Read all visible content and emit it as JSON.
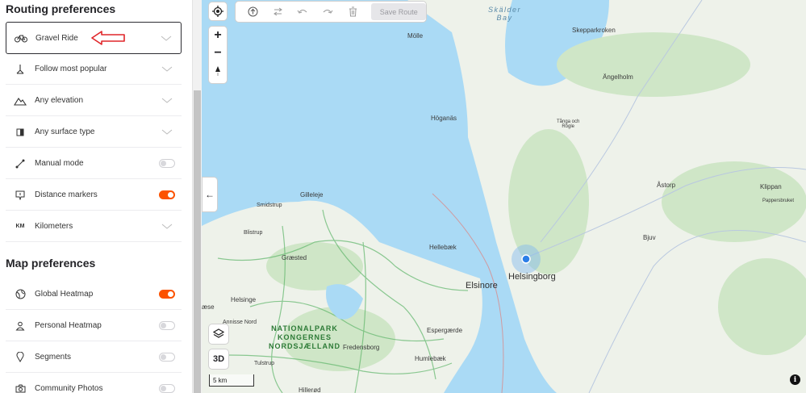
{
  "routing": {
    "title": "Routing preferences",
    "items": [
      {
        "label": "Gravel Ride",
        "control": "chevron"
      },
      {
        "label": "Follow most popular",
        "control": "chevron"
      },
      {
        "label": "Any elevation",
        "control": "chevron"
      },
      {
        "label": "Any surface type",
        "control": "chevron"
      },
      {
        "label": "Manual mode",
        "control": "toggle",
        "on": false
      },
      {
        "label": "Distance markers",
        "control": "toggle",
        "on": true
      },
      {
        "label": "Kilometers",
        "control": "chevron",
        "icon_text": "KM"
      }
    ]
  },
  "map_prefs": {
    "title": "Map preferences",
    "items": [
      {
        "label": "Global Heatmap",
        "control": "toggle",
        "on": true
      },
      {
        "label": "Personal Heatmap",
        "control": "toggle",
        "on": false
      },
      {
        "label": "Segments",
        "control": "toggle",
        "on": false
      },
      {
        "label": "Community Photos",
        "control": "toggle",
        "on": false
      }
    ]
  },
  "toolbar": {
    "save_label": "Save Route"
  },
  "map_controls": {
    "zoom_in": "+",
    "zoom_out": "−",
    "three_d": "3D",
    "info": "i",
    "collapse": "←"
  },
  "scale": {
    "label": "5 km"
  },
  "map_labels": {
    "water": {
      "skalder_line1": "Skälder",
      "skalder_line2": "Bay"
    },
    "park": {
      "line1": "NATIONALPARK",
      "line2": "KONGERNES",
      "line3": "NORDSJÆLLAND"
    },
    "cities": {
      "helsingborg": "Helsingborg",
      "elsinore": "Elsinore"
    },
    "towns": {
      "molle": "Mölle",
      "skepparkroken": "Skepparkroken",
      "angelholm": "Ängelholm",
      "hoganas": "Höganäs",
      "tanga1": "Tånga och",
      "tanga2": "Rögle",
      "astorp": "Åstorp",
      "klippan": "Klippan",
      "pappersbruket": "Pappersbruket",
      "bjuv": "Bjuv",
      "gilleleje": "Gilleleje",
      "smidstrup": "Smidstrup",
      "blistrup": "Blistrup",
      "hellebaek": "Hellebæk",
      "graested": "Græsted",
      "helsinge": "Helsinge",
      "aese": "æse",
      "annisse": "Annisse Nord",
      "espergaerde": "Espergærde",
      "fredensborg": "Fredensborg",
      "humlebaek": "Humlebæk",
      "tulstrup": "Tulstrup",
      "hillerod": "Hillerød"
    }
  },
  "colors": {
    "accent": "#fc5200",
    "arrow": "#e0262a",
    "water": "#aadaf5",
    "land": "#eef2ea",
    "forest": "#cfe6c7"
  }
}
